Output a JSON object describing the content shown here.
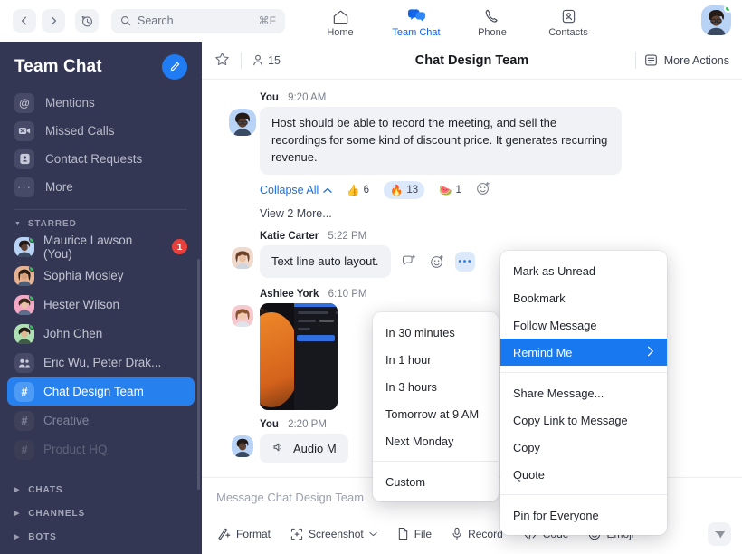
{
  "topbar": {
    "back_icon": "chevron-left-icon",
    "forward_icon": "chevron-right-icon",
    "history_icon": "history-clock-icon",
    "search_placeholder": "Search",
    "search_icon": "search-icon",
    "search_shortcut": "⌘F",
    "tabs": [
      {
        "label": "Home",
        "icon": "home-icon",
        "active": false
      },
      {
        "label": "Team Chat",
        "icon": "team-chat-icon",
        "active": true
      },
      {
        "label": "Phone",
        "icon": "phone-icon",
        "active": false
      },
      {
        "label": "Contacts",
        "icon": "contacts-icon",
        "active": false
      }
    ],
    "avatar_name": "user-avatar",
    "presence": "online"
  },
  "sidebar": {
    "title": "Team Chat",
    "compose_icon": "compose-pencil-icon",
    "quick_items": [
      {
        "label": "Mentions",
        "icon": "at-icon"
      },
      {
        "label": "Missed Calls",
        "icon": "missed-video-call-icon"
      },
      {
        "label": "Contact Requests",
        "icon": "contact-request-icon"
      },
      {
        "label": "More",
        "icon": "ellipsis-icon"
      }
    ],
    "starred_group": "STARRED",
    "starred": [
      {
        "label": "Maurice Lawson (You)",
        "type": "person",
        "online": true,
        "badge": "1",
        "style": ""
      },
      {
        "label": "Sophia Mosley",
        "type": "person",
        "online": true,
        "badge": "",
        "style": ""
      },
      {
        "label": "Hester Wilson",
        "type": "person",
        "online": true,
        "badge": "",
        "style": ""
      },
      {
        "label": "John Chen",
        "type": "person",
        "online": true,
        "badge": "",
        "style": ""
      },
      {
        "label": "Eric Wu, Peter Drak...",
        "type": "group",
        "online": false,
        "badge": "",
        "style": ""
      },
      {
        "label": "Chat Design Team",
        "type": "channel",
        "online": false,
        "badge": "",
        "style": "selected"
      },
      {
        "label": "Creative",
        "type": "channel",
        "online": false,
        "badge": "",
        "style": "dim"
      },
      {
        "label": "Product HQ",
        "type": "channel",
        "online": false,
        "badge": "",
        "style": "dim2"
      }
    ],
    "bottom_groups": [
      {
        "label": "CHATS"
      },
      {
        "label": "CHANNELS"
      },
      {
        "label": "BOTS"
      }
    ]
  },
  "chat_header": {
    "star_icon": "star-outline-icon",
    "members_icon": "member-icon",
    "member_count": "15",
    "title": "Chat Design Team",
    "more_actions_label": "More Actions",
    "more_actions_icon": "list-panel-icon"
  },
  "messages": [
    {
      "author": "You",
      "time": "9:20 AM",
      "text": "Host should be able to record the meeting, and sell the recordings for some kind of discount price. It generates recurring revenue.",
      "collapse_label": "Collapse All",
      "collapse_icon": "chevron-up-icon",
      "reactions": [
        {
          "emoji": "👍",
          "count": "6",
          "highlighted": false
        },
        {
          "emoji": "🔥",
          "count": "13",
          "highlighted": true
        },
        {
          "emoji": "🍉",
          "count": "1",
          "highlighted": false
        }
      ],
      "add_reaction_icon": "add-emoji-icon",
      "view_more": "View 2 More..."
    },
    {
      "author": "Katie Carter",
      "time": "5:22 PM",
      "text": "Text line auto layout.",
      "hover_icons": [
        {
          "name": "reply-thread-icon",
          "active": false
        },
        {
          "name": "add-emoji-icon",
          "active": false
        },
        {
          "name": "more-options-icon",
          "active": true
        }
      ]
    },
    {
      "author": "Ashlee York",
      "time": "6:10 PM",
      "attachment": "image-thumbnail"
    },
    {
      "author": "You",
      "time": "2:20 PM",
      "text": "Audio M",
      "audio_icon": "audio-wave-icon"
    }
  ],
  "context_menu": {
    "items": [
      {
        "label": "Mark as Unread",
        "highlighted": false,
        "submenu": false,
        "divider_after": false
      },
      {
        "label": "Bookmark",
        "highlighted": false,
        "submenu": false,
        "divider_after": false
      },
      {
        "label": "Follow Message",
        "highlighted": false,
        "submenu": false,
        "divider_after": false
      },
      {
        "label": "Remind Me",
        "highlighted": true,
        "submenu": true,
        "divider_after": true
      },
      {
        "label": "Share Message...",
        "highlighted": false,
        "submenu": false,
        "divider_after": false
      },
      {
        "label": "Copy Link to Message",
        "highlighted": false,
        "submenu": false,
        "divider_after": false
      },
      {
        "label": "Copy",
        "highlighted": false,
        "submenu": false,
        "divider_after": false
      },
      {
        "label": "Quote",
        "highlighted": false,
        "submenu": false,
        "divider_after": true
      },
      {
        "label": "Pin for Everyone",
        "highlighted": false,
        "submenu": false,
        "divider_after": false
      }
    ],
    "submenu_arrow": "chevron-right-icon"
  },
  "remind_submenu": {
    "items": [
      {
        "label": "In 30 minutes",
        "divider_after": false
      },
      {
        "label": "In 1 hour",
        "divider_after": false
      },
      {
        "label": "In 3 hours",
        "divider_after": false
      },
      {
        "label": "Tomorrow at 9 AM",
        "divider_after": false
      },
      {
        "label": "Next Monday",
        "divider_after": true
      },
      {
        "label": "Custom",
        "divider_after": false
      }
    ]
  },
  "composer": {
    "placeholder": "Message Chat Design Team",
    "tools": [
      {
        "label": "Format",
        "icon": "format-text-icon",
        "caret": false
      },
      {
        "label": "Screenshot",
        "icon": "screenshot-icon",
        "caret": true
      },
      {
        "label": "File",
        "icon": "file-icon",
        "caret": false
      },
      {
        "label": "Record",
        "icon": "microphone-icon",
        "caret": false
      },
      {
        "label": "Code",
        "icon": "code-icon",
        "caret": false
      },
      {
        "label": "Emoji",
        "icon": "emoji-icon",
        "caret": false
      }
    ],
    "send_icon": "send-paper-plane-icon"
  },
  "colors": {
    "sidebar_bg": "#343753",
    "accent_blue": "#1f7cf2",
    "selected_item": "#2681ef",
    "menu_highlight": "#1878f0",
    "badge_red": "#e8403a",
    "online_green": "#2bc653"
  }
}
